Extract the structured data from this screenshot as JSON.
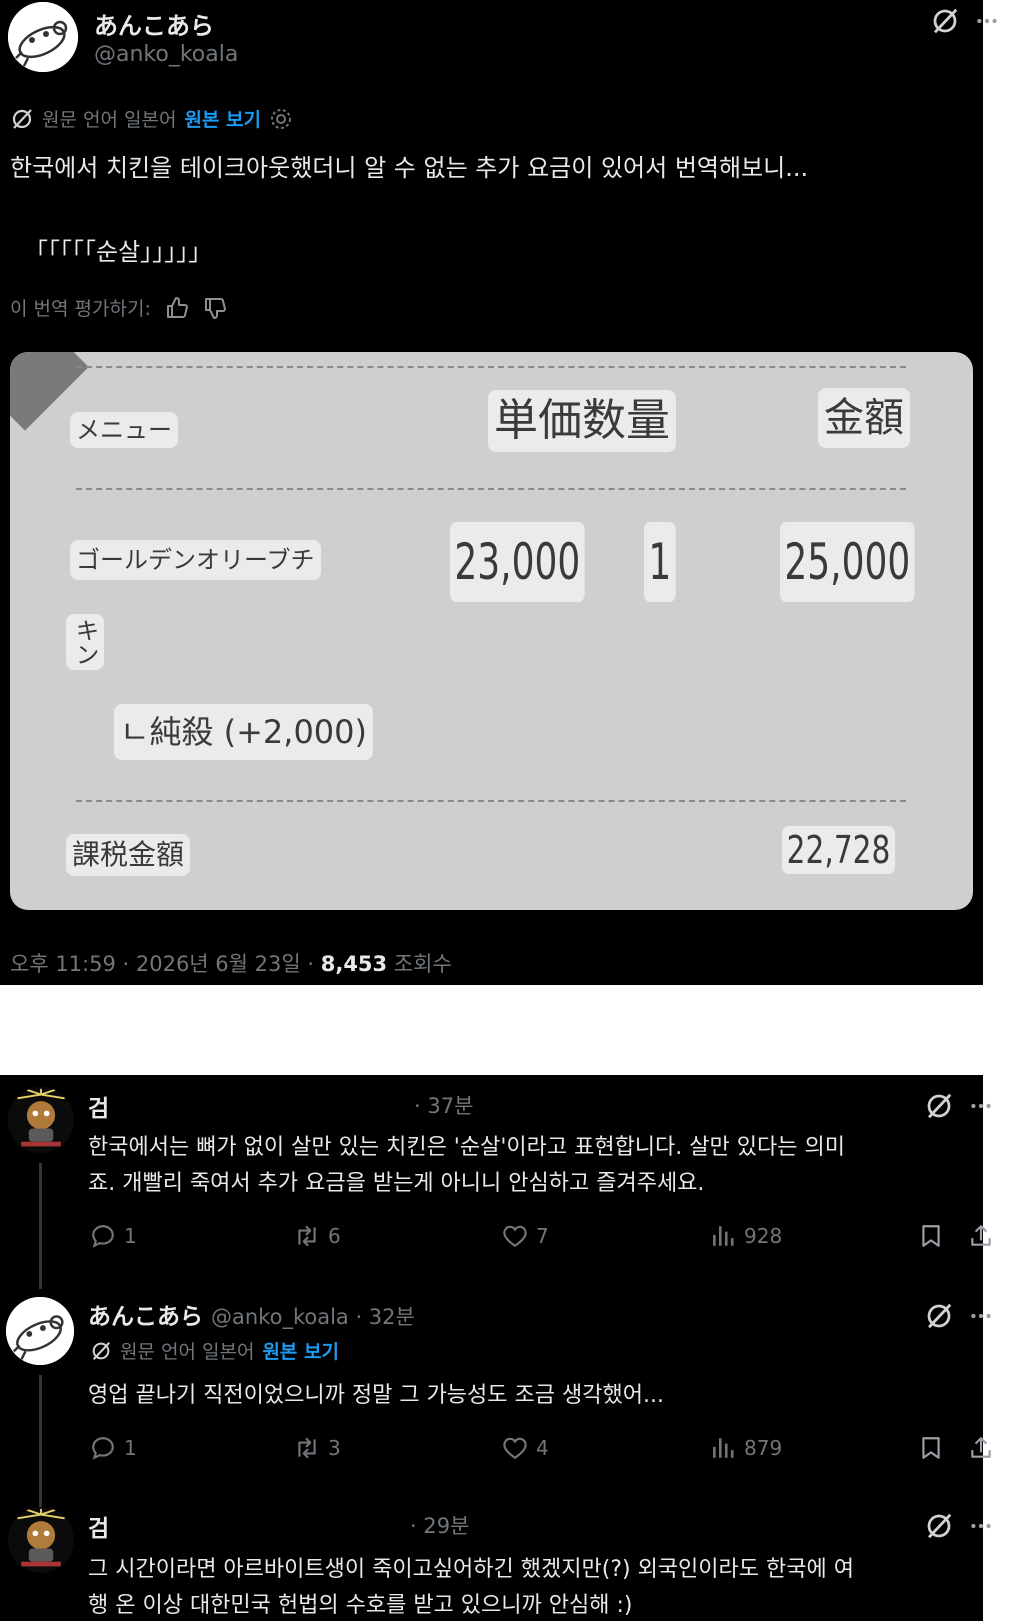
{
  "post": {
    "display_name": "あんこあら",
    "handle": "@anko_koala",
    "translation_bar": {
      "source": "원문 언어 일본어",
      "view_original": "원본 보기"
    },
    "text_line1": "한국에서 치킨을 테이크아웃했더니 알 수 없는 추가 요금이 있어서 번역해보니...",
    "text_line2": "「「「「「순살」」」」」",
    "rate_translation": "이 번역 평가하기:",
    "receipt": {
      "menu_header": "メニュー",
      "unit_qty_header": "単価数量",
      "amount_header": "金額",
      "item_name": "ゴールデンオリーブチ",
      "item_name_cont": "キン",
      "unit_price": "23,000",
      "quantity": "1",
      "amount": "25,000",
      "option": "ㄴ純殺 (+2,000)",
      "taxable_label": "課税金額",
      "taxable_amount": "22,728"
    },
    "meta": {
      "time": "오후 11:59 · 2026년 6월 23일 · ",
      "views": "8,453",
      "views_label": " 조회수"
    }
  },
  "replies": [
    {
      "name": "검",
      "time": "· 37분",
      "text_line1": "한국에서는 뼈가 없이 살만 있는 치킨은 '순살'이라고 표현합니다. 살만 있다는 의미",
      "text_line2": "죠. 개빨리 죽여서 추가 요금을 받는게 아니니 안심하고 즐겨주세요.",
      "replies_count": "1",
      "retweets_count": "6",
      "likes_count": "7",
      "views_count": "928"
    },
    {
      "name": "あんこあら",
      "handle_time": "@anko_koala · 32분",
      "translation_source": "원문 언어 일본어",
      "view_original": "원본 보기",
      "text_line1": "영업 끝나기 직전이었으니까 정말 그 가능성도 조금 생각했어...",
      "replies_count": "1",
      "retweets_count": "3",
      "likes_count": "4",
      "views_count": "879"
    },
    {
      "name": "검",
      "time": "· 29분",
      "text_line1": "그 시간이라면 아르바이트생이 죽이고싶어하긴 했겠지만(?) 외국인이라도 한국에 여",
      "text_line2": "행 온 이상 대한민국 헌법의 수호를 받고 있으니까 안심해 :)"
    }
  ],
  "icons": {
    "grok": "grok-icon",
    "more": "more-icon",
    "translate": "translate-icon",
    "settings": "gear-icon",
    "thumbs_up": "thumbs-up-icon",
    "thumbs_down": "thumbs-down-icon",
    "reply": "reply-icon",
    "retweet": "retweet-icon",
    "like": "heart-icon",
    "views": "views-icon",
    "bookmark": "bookmark-icon",
    "share": "share-icon"
  },
  "colors": {
    "background": "#000000",
    "text": "#e7e9ea",
    "muted": "#71767b",
    "link": "#1d9bf0"
  }
}
